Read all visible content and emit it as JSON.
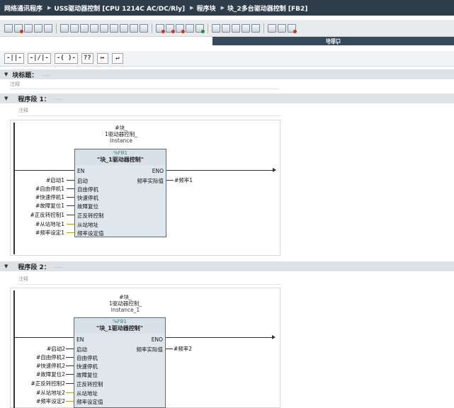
{
  "breadcrumb": [
    "网络通讯程序",
    "USS驱动器控制 [CPU 1214C AC/DC/Rly]",
    "程序块",
    "块_2多台驱动器控制 [FB2]"
  ],
  "interface_panel": {
    "label": "块接口"
  },
  "lad_toolbar": [
    "-||-",
    "-|/|-",
    "-( )-",
    "??",
    "↦",
    "↵"
  ],
  "block_title": {
    "label": "块标题：",
    "placeholder": "....",
    "comment": "注释"
  },
  "networks": [
    {
      "label": "程序段 1：",
      "placeholder": "....",
      "comment": "注释",
      "instance_lines": [
        "#块_",
        "1驱动器控制_",
        "Instance"
      ],
      "fb_number": "%FB1",
      "fb_name": "\"块_1驱动器控制\"",
      "en": "EN",
      "eno": "ENO",
      "inputs": [
        {
          "operand": "#启动1",
          "pin": "启动"
        },
        {
          "operand": "#自由停机1",
          "pin": "自由停机"
        },
        {
          "operand": "#快速停机1",
          "pin": "快速停机"
        },
        {
          "operand": "#故障复位1",
          "pin": "故障复位"
        },
        {
          "operand": "#正反转控制1",
          "pin": "正反转控制"
        },
        {
          "operand": "#从站地址1",
          "pin": "从站地址"
        },
        {
          "operand": "#频率设定1",
          "pin": "频率设定值"
        }
      ],
      "output": {
        "pin": "频率实际值",
        "operand": "#频率1"
      }
    },
    {
      "label": "程序段 2：",
      "placeholder": "....",
      "comment": "注释",
      "instance_lines": [
        "#块_",
        "1驱动器控制_",
        "Instance_1"
      ],
      "fb_number": "%FB1",
      "fb_name": "\"块_1驱动器控制\"",
      "en": "EN",
      "eno": "ENO",
      "inputs": [
        {
          "operand": "#启动2",
          "pin": "启动"
        },
        {
          "operand": "#自由停机2",
          "pin": "自由停机"
        },
        {
          "operand": "#快速停机2",
          "pin": "快速停机"
        },
        {
          "operand": "#故障复位2",
          "pin": "故障复位"
        },
        {
          "operand": "#正反转控制2",
          "pin": "正反转控制"
        },
        {
          "operand": "#从站地址2",
          "pin": "从站地址"
        },
        {
          "operand": "#频率设定2",
          "pin": "频率设定值"
        }
      ],
      "output": {
        "pin": "频率实际值",
        "operand": "#频率2"
      }
    }
  ]
}
